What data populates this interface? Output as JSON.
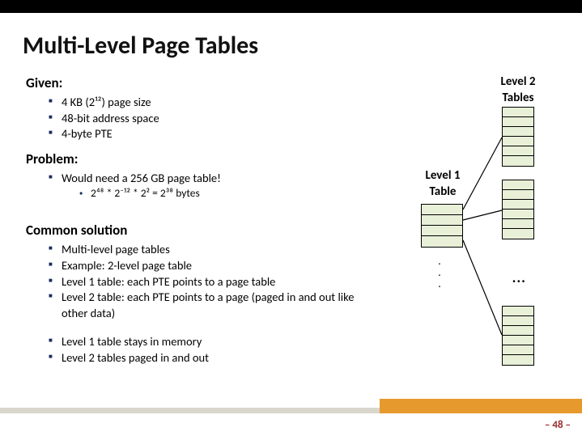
{
  "title": "Multi-Level Page Tables",
  "sections": {
    "given": {
      "head": "Given:",
      "items": [
        "4 KB (2¹²) page size",
        "48-bit address space",
        "4-byte PTE"
      ]
    },
    "problem": {
      "head": "Problem:",
      "items": [
        "Would need a 256 GB page table!"
      ],
      "sub": [
        "2⁴⁸ * 2⁻¹² * 2² = 2³⁸ bytes"
      ]
    },
    "common": {
      "head": "Common solution",
      "items_a": [
        "Multi-level page tables",
        "Example: 2-level page table",
        "Level 1 table: each PTE points to a page table",
        "Level 2 table: each PTE points to a page (paged in and out like other data)"
      ],
      "items_b": [
        "Level 1 table stays in memory",
        "Level 2 tables paged in and out"
      ]
    }
  },
  "diagram": {
    "level2_label1": "Level 2",
    "level2_label2": "Tables",
    "level1_label1": "Level 1",
    "level1_label2": "Table",
    "vdots": "...",
    "hdots": "..."
  },
  "pagenum": "– 48 –"
}
